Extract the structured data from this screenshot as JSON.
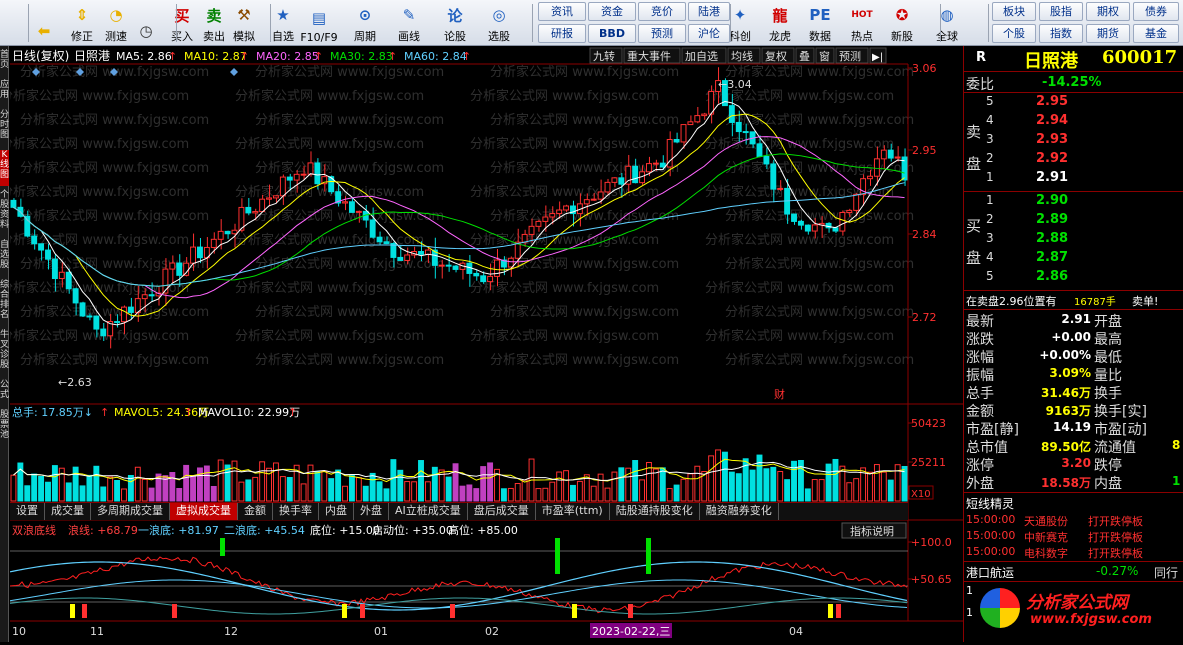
{
  "toolbar": {
    "buttons": [
      {
        "label": "",
        "icon": "back-arrow-icon"
      },
      {
        "label": "修正",
        "icon": "up-down-arrows-icon"
      },
      {
        "label": "测速",
        "icon": "speed-test-icon"
      },
      {
        "label": "",
        "icon": "clock-icon"
      },
      {
        "label": "买入",
        "icon": "buy-icon",
        "glyph": "买"
      },
      {
        "label": "卖出",
        "icon": "sell-icon",
        "glyph": "卖"
      },
      {
        "label": "模拟",
        "icon": "hammer-icon"
      },
      {
        "label": "自选",
        "icon": "star-icon"
      },
      {
        "label": "F10/F9",
        "icon": "f10-icon"
      },
      {
        "label": "周期",
        "icon": "period-icon"
      },
      {
        "label": "画线",
        "icon": "pencil-icon"
      },
      {
        "label": "论股",
        "icon": "forum-icon",
        "glyph": "论"
      },
      {
        "label": "选股",
        "icon": "select-stock-icon"
      },
      {
        "label": "科创",
        "icon": "kechuang-icon"
      },
      {
        "label": "龙虎",
        "icon": "dragon-tiger-icon"
      },
      {
        "label": "数据",
        "icon": "data-icon"
      },
      {
        "label": "热点",
        "icon": "hot-icon"
      },
      {
        "label": "新股",
        "icon": "new-stock-icon"
      },
      {
        "label": "全球",
        "icon": "globe-icon"
      }
    ],
    "small_buttons": [
      "资讯",
      "资金",
      "竞价",
      "陆港",
      "研报",
      "BBD",
      "预测",
      "沪伦",
      "板块",
      "股指",
      "期权",
      "债券",
      "个股",
      "指数",
      "期货",
      "基金"
    ]
  },
  "left_nav": [
    "首页",
    "应用",
    "分时图",
    "K线图",
    "个股资料",
    "自选股",
    "综合排名",
    "牛叉诊股",
    "公式",
    "股票池"
  ],
  "chart": {
    "header": {
      "title": "日线(复权)",
      "name": "日照港",
      "ma": [
        {
          "label": "MA5: 2.86",
          "color": "#ffffff"
        },
        {
          "label": "MA10: 2.87",
          "color": "#ffff00"
        },
        {
          "label": "MA20: 2.85",
          "color": "#ff66ff"
        },
        {
          "label": "MA30: 2.83",
          "color": "#00e000"
        },
        {
          "label": "MA60: 2.84",
          "color": "#60d0ff"
        }
      ],
      "buttons": [
        "九转",
        "重大事件",
        "加自选",
        "均线",
        "复权",
        "叠",
        "窗",
        "预测"
      ]
    },
    "price_axis": [
      "3.06",
      "2.95",
      "2.84",
      "2.72"
    ],
    "annotations": {
      "high": "3.04",
      "low": "2.63",
      "fin": "财"
    },
    "watermark": "分析家公式网 www.fxjgsw.com",
    "volume": {
      "header": [
        {
          "label": "总手: 17.85万↓",
          "color": "#60d0ff"
        },
        {
          "label": "MAVOL5: 24.36万",
          "color": "#ffff00"
        },
        {
          "label": "MAVOL10: 22.99万",
          "color": "#ffffff"
        }
      ],
      "axis": [
        "50423",
        "25211"
      ],
      "unit": "X10"
    },
    "indicator": {
      "header": [
        {
          "label": "双浪底线",
          "color": "#ff4040"
        },
        {
          "label": "浪线: +68.79",
          "color": "#ff4040"
        },
        {
          "label": "一浪底: +81.97",
          "color": "#60d0ff"
        },
        {
          "label": "二浪底: +45.54",
          "color": "#60d0ff"
        },
        {
          "label": "底位: +15.00",
          "color": "#ffffff"
        },
        {
          "label": "启动位: +35.00",
          "color": "#ffffff"
        },
        {
          "label": "高位: +85.00",
          "color": "#ffffff"
        }
      ],
      "explain": "指标说明",
      "axis": [
        "+100.0",
        "+50.65"
      ]
    },
    "x_axis": [
      {
        "label": "10",
        "pos": 0
      },
      {
        "label": "11",
        "pos": 78
      },
      {
        "label": "12",
        "pos": 212
      },
      {
        "label": "01",
        "pos": 362
      },
      {
        "label": "02",
        "pos": 473
      },
      {
        "label": "2023-02-22,三",
        "pos": 580,
        "highlight": true
      },
      {
        "label": "04",
        "pos": 777
      }
    ]
  },
  "tabs": [
    "设置",
    "成交量",
    "多周期成交量",
    "虚拟成交量",
    "金额",
    "换手率",
    "内盘",
    "外盘",
    "AI立桩成交量",
    "盘后成交量",
    "市盈率(ttm)",
    "陆股通持股变化",
    "融资融券变化"
  ],
  "active_tab": 3,
  "right_panel": {
    "r_label": "R",
    "name": "日照港",
    "code": "600017",
    "wei_bi": {
      "label": "委比",
      "value": "-14.25%"
    },
    "sell_label": "卖盘",
    "buy_label": "买盘",
    "sell": [
      {
        "level": "5",
        "price": "2.95"
      },
      {
        "level": "4",
        "price": "2.94"
      },
      {
        "level": "3",
        "price": "2.93"
      },
      {
        "level": "2",
        "price": "2.92"
      },
      {
        "level": "1",
        "price": "2.91"
      }
    ],
    "buy": [
      {
        "level": "1",
        "price": "2.90"
      },
      {
        "level": "2",
        "price": "2.89"
      },
      {
        "level": "3",
        "price": "2.88"
      },
      {
        "level": "4",
        "price": "2.87"
      },
      {
        "level": "5",
        "price": "2.86"
      }
    ],
    "notice": {
      "text": "在卖盘2.96位置有",
      "vol": "16787手",
      "action": "卖单!"
    },
    "stats": [
      {
        "k": "最新",
        "v": "2.91",
        "vc": "#ffffff",
        "k2": "开盘",
        "v2": ""
      },
      {
        "k": "涨跌",
        "v": "+0.00",
        "vc": "#ffffff",
        "k2": "最高",
        "v2": ""
      },
      {
        "k": "涨幅",
        "v": "+0.00%",
        "vc": "#ffffff",
        "k2": "最低",
        "v2": ""
      },
      {
        "k": "振幅",
        "v": "3.09%",
        "vc": "#ffff00",
        "k2": "量比",
        "v2": ""
      },
      {
        "k": "总手",
        "v": "31.46万",
        "vc": "#ffff00",
        "k2": "换手",
        "v2": ""
      },
      {
        "k": "金额",
        "v": "9163万",
        "vc": "#ffff00",
        "k2": "换手[实]",
        "v2": ""
      },
      {
        "k": "市盈[静]",
        "v": "14.19",
        "vc": "#ffffff",
        "k2": "市盈[动]",
        "v2": ""
      },
      {
        "k": "总市值",
        "v": "89.50亿",
        "vc": "#ffff00",
        "k2": "流通值",
        "v2": "8"
      },
      {
        "k": "涨停",
        "v": "3.20",
        "vc": "#ff3030",
        "k2": "跌停",
        "v2": ""
      },
      {
        "k": "外盘",
        "v": "18.58万",
        "vc": "#ff3030",
        "k2": "内盘",
        "v2": "1"
      }
    ],
    "spirit_title": "短线精灵",
    "spirit": [
      {
        "time": "15:00:00",
        "name": "天通股份",
        "event": "打开跌停板"
      },
      {
        "time": "15:00:00",
        "name": "中新赛克",
        "event": "打开跌停板"
      },
      {
        "time": "15:00:00",
        "name": "电科数字",
        "event": "打开跌停板"
      }
    ],
    "sector": {
      "name": "港口航运",
      "pct": "-0.27%",
      "extra": "同行"
    },
    "logo_text": "分析家公式网",
    "logo_url": "www.fxjgsw.com"
  }
}
